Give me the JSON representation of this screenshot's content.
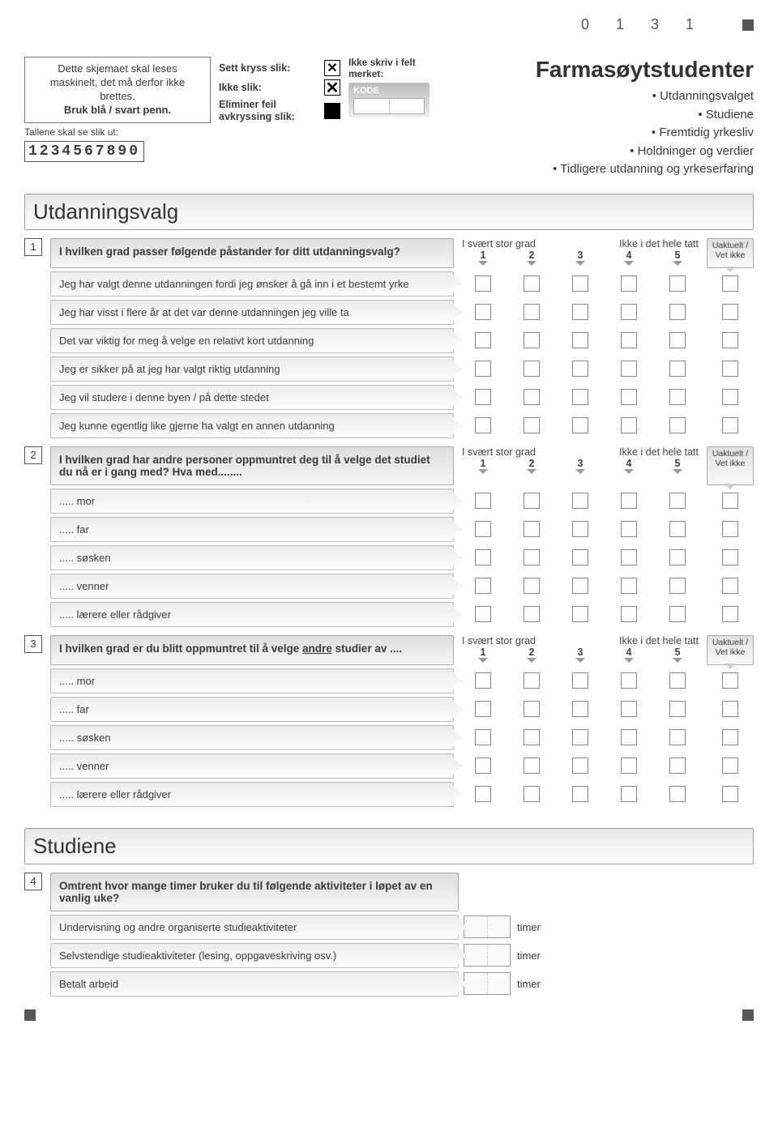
{
  "page_code": "0 1 3    1",
  "instructions": {
    "line1": "Dette skjemaet skal leses maskinelt, det må derfor ikke brettes.",
    "line2": "Bruk blå / svart penn.",
    "num_label": "Tallene skal se slik ut:",
    "num_example": "1234567890"
  },
  "marks": {
    "sett": "Sett kryss slik:",
    "ikke": "Ikke slik:",
    "elim": "Eliminer feil avkryssing slik:"
  },
  "kode": {
    "lbl": "Ikke skriv i felt merket:",
    "box": "KODE"
  },
  "title": "Farmasøytstudenter",
  "bullets": [
    "Utdanningsvalget",
    "Studiene",
    "Fremtidig yrkesliv",
    "Holdninger og verdier",
    "Tidligere utdanning og yrkeserfaring"
  ],
  "sections": {
    "s1": "Utdanningsvalg",
    "s2": "Studiene"
  },
  "scale": {
    "left": "I svært stor grad",
    "right": "Ikke i det hele tatt",
    "nums": [
      "1",
      "2",
      "3",
      "4",
      "5"
    ],
    "na": "Uaktuelt / Vet ikke"
  },
  "q1": {
    "num": "1",
    "text": "I hvilken grad passer følgende påstander for ditt utdanningsvalg?",
    "items": [
      "Jeg har valgt denne utdanningen fordi jeg ønsker å gå inn i et bestemt yrke",
      "Jeg har visst i flere år at det var denne utdanningen jeg ville ta",
      "Det var viktig for meg å velge en relativt kort utdanning",
      "Jeg er sikker på at jeg har valgt riktig utdanning",
      "Jeg vil studere i denne byen / på dette stedet",
      "Jeg kunne egentlig like gjerne ha valgt en annen utdanning"
    ]
  },
  "q2": {
    "num": "2",
    "text": "I hvilken grad har andre personer oppmuntret deg til å velge det studiet du nå er i gang med? Hva med........",
    "items": [
      "..... mor",
      "..... far",
      "..... søsken",
      "..... venner",
      "..... lærere eller rådgiver"
    ]
  },
  "q3": {
    "num": "3",
    "text_pre": "I hvilken grad er du blitt oppmuntret til å velge ",
    "text_u": "andre",
    "text_post": " studier av ....",
    "items": [
      "..... mor",
      "..... far",
      "..... søsken",
      "..... venner",
      "..... lærere eller rådgiver"
    ]
  },
  "q4": {
    "num": "4",
    "text": "Omtrent hvor mange timer bruker du til følgende aktiviteter i løpet av en vanlig uke?",
    "items": [
      "Undervisning og andre organiserte studieaktiviteter",
      "Selvstendige studieaktiviteter (lesing, oppgaveskriving osv.)",
      "Betalt arbeid"
    ],
    "unit": "timer"
  }
}
